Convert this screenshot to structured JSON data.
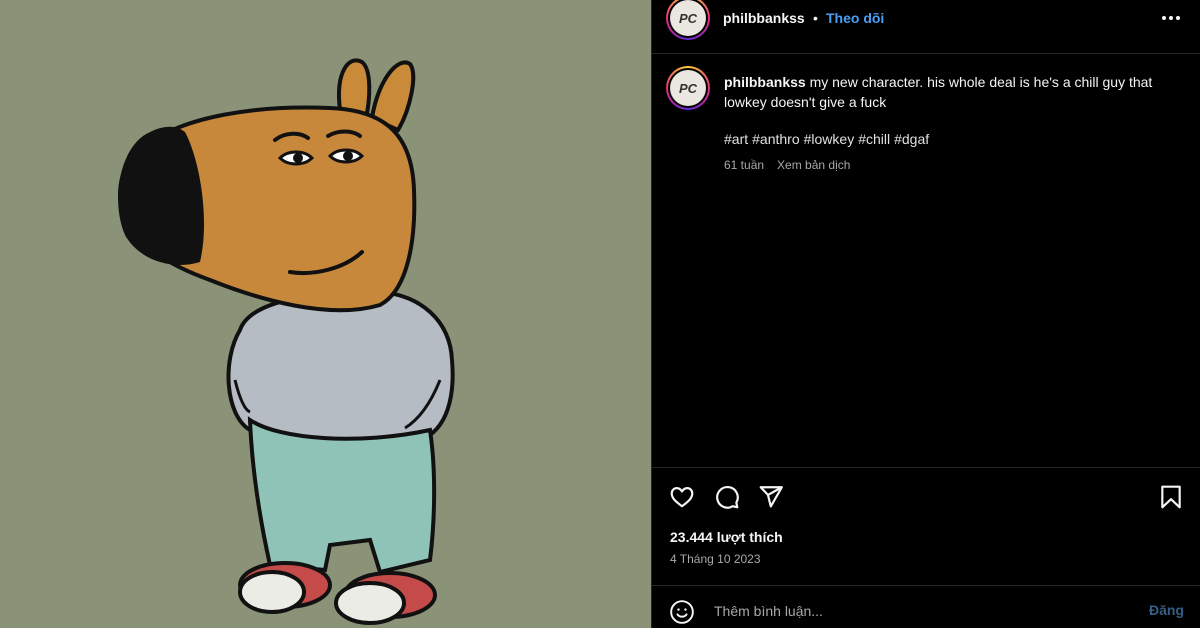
{
  "post": {
    "username": "philbbankss",
    "separator": "•",
    "follow_label": "Theo dõi",
    "avatar_text": "PC",
    "caption_text": "my new character. his whole deal is he's a chill guy that lowkey doesn't give a fuck",
    "hashtags": [
      "#art",
      "#anthro",
      "#lowkey",
      "#chill",
      "#dgaf"
    ],
    "time_ago": "61 tuần",
    "translate_label": "Xem bản dịch",
    "likes": "23.444 lượt thích",
    "date": "4 Tháng 10 2023",
    "comment_placeholder": "Thêm bình luận...",
    "post_label": "Đăng"
  },
  "icons": {
    "more": "more-horizontal-icon",
    "like": "heart-icon",
    "comment": "comment-icon",
    "share": "paper-plane-icon",
    "save": "bookmark-icon",
    "emoji": "emoji-icon"
  },
  "colors": {
    "background": "#000000",
    "media_background": "#8a9377",
    "follow": "#4a9ff5",
    "post_button": "#355f85",
    "secondary_text": "#a8a8a8",
    "divider": "#262626"
  }
}
